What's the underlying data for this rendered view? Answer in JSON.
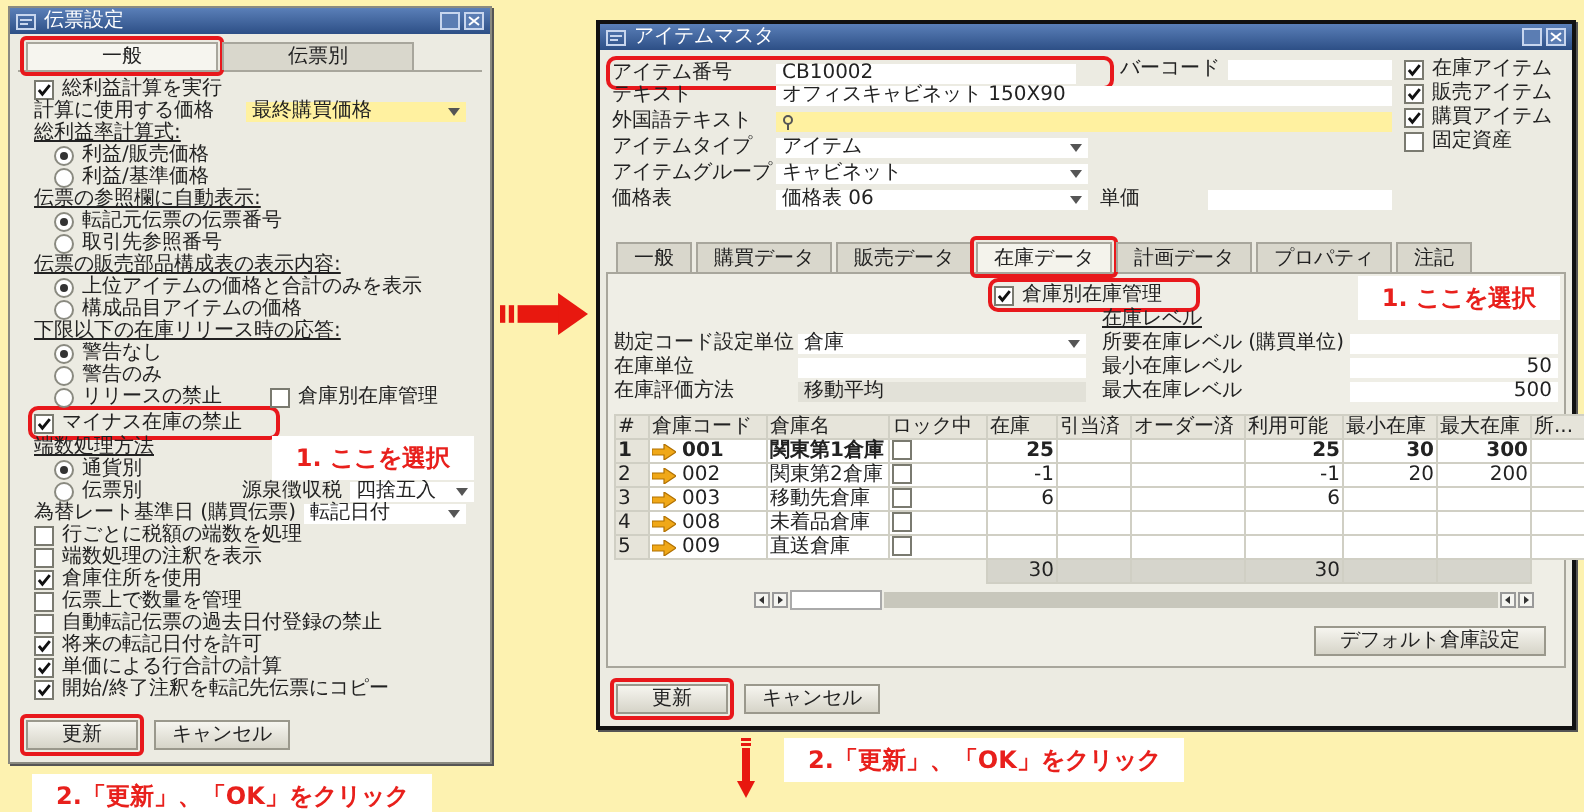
{
  "left_window": {
    "title": "伝票設定",
    "tabs": [
      {
        "label": "一般",
        "selected": true,
        "highlighted": true
      },
      {
        "label": "伝票別",
        "selected": false,
        "highlighted": false
      }
    ],
    "items": [
      {
        "kind": "checkbox",
        "label": "総利益計算を実行",
        "checked": true,
        "highlighted": false
      },
      {
        "kind": "dropdown",
        "label": "計算に使用する価格",
        "value": "最終購買価格",
        "focused": true
      },
      {
        "kind": "radio_group",
        "heading": "総利益率計算式:",
        "options": [
          {
            "label": "利益/販売価格",
            "selected": true
          },
          {
            "label": "利益/基準価格",
            "selected": false
          }
        ]
      },
      {
        "kind": "radio_group",
        "heading": "伝票の参照欄に自動表示:",
        "options": [
          {
            "label": "転記元伝票の伝票番号",
            "selected": true
          },
          {
            "label": "取引先参照番号",
            "selected": false
          }
        ]
      },
      {
        "kind": "radio_group",
        "heading": "伝票の販売部品構成表の表示内容:",
        "options": [
          {
            "label": "上位アイテムの価格と合計のみを表示",
            "selected": true
          },
          {
            "label": "構成品目アイテムの価格",
            "selected": false
          }
        ]
      },
      {
        "kind": "radio_group",
        "heading": "下限以下の在庫リリース時の応答:",
        "options": [
          {
            "label": "警告なし",
            "selected": true
          },
          {
            "label": "警告のみ",
            "selected": false
          },
          {
            "label": "リリースの禁止",
            "selected": false
          }
        ],
        "side_checkbox": {
          "label": "倉庫別在庫管理",
          "checked": false
        }
      },
      {
        "kind": "checkbox",
        "label": "マイナス在庫の禁止",
        "checked": true,
        "highlighted": true
      },
      {
        "kind": "radio_group",
        "heading": "端数処理方法",
        "options": [
          {
            "label": "通貨別",
            "selected": true
          },
          {
            "label": "伝票別",
            "selected": false
          }
        ],
        "side_dropdown": {
          "label": "源泉徴収税",
          "value": "四捨五入"
        }
      },
      {
        "kind": "dropdown",
        "label": "為替レート基準日 (購買伝票)",
        "value": "転記日付",
        "focused": false
      },
      {
        "kind": "checkbox",
        "label": "行ごとに税額の端数を処理",
        "checked": false,
        "highlighted": false
      },
      {
        "kind": "checkbox",
        "label": "端数処理の注釈を表示",
        "checked": false,
        "highlighted": false
      },
      {
        "kind": "checkbox",
        "label": "倉庫住所を使用",
        "checked": true,
        "highlighted": false
      },
      {
        "kind": "checkbox",
        "label": "伝票上で数量を管理",
        "checked": false,
        "highlighted": false
      },
      {
        "kind": "checkbox",
        "label": "自動転記伝票の過去日付登録の禁止",
        "checked": false,
        "highlighted": false
      },
      {
        "kind": "checkbox",
        "label": "将来の転記日付を許可",
        "checked": true,
        "highlighted": false
      },
      {
        "kind": "checkbox",
        "label": "単価による行合計の計算",
        "checked": true,
        "highlighted": false
      },
      {
        "kind": "checkbox",
        "label": "開始/終了注釈を転記先伝票にコピー",
        "checked": true,
        "highlighted": false
      }
    ],
    "buttons": [
      {
        "label": "更新",
        "highlighted": true
      },
      {
        "label": "キャンセル",
        "highlighted": false
      }
    ],
    "callouts": [
      "1. ここを選択",
      "2.「更新」、「OK」をクリック"
    ]
  },
  "right_window": {
    "title": "アイテムマスタ",
    "header_fields": [
      {
        "kind": "text",
        "label": "アイテム番号",
        "value": "CB10002",
        "focused": false,
        "highlighted": true
      },
      {
        "kind": "text",
        "label": "テキスト",
        "value": "オフィスキャビネット 150X90",
        "focused": false,
        "highlighted": false
      },
      {
        "kind": "text",
        "label": "外国語テキスト",
        "focused": true,
        "highlighted": false
      },
      {
        "kind": "dropdown",
        "label": "アイテムタイプ",
        "value": "アイテム",
        "highlighted": false
      },
      {
        "kind": "dropdown",
        "label": "アイテムグループ",
        "value": "キャビネット",
        "highlighted": false
      },
      {
        "kind": "dropdown",
        "label": "価格表",
        "value": "価格表 06",
        "highlighted": false
      }
    ],
    "barcode": {
      "label": "バーコード"
    },
    "unit_price": {
      "label": "単価"
    },
    "item_flags": [
      {
        "label": "在庫アイテム",
        "checked": true
      },
      {
        "label": "販売アイテム",
        "checked": true
      },
      {
        "label": "購買アイテム",
        "checked": true
      },
      {
        "label": "固定資産",
        "checked": false
      }
    ],
    "tabs": [
      {
        "label": "一般",
        "selected": false,
        "highlighted": false
      },
      {
        "label": "購買データ",
        "selected": false,
        "highlighted": false
      },
      {
        "label": "販売データ",
        "selected": false,
        "highlighted": false
      },
      {
        "label": "在庫データ",
        "selected": true,
        "highlighted": true
      },
      {
        "label": "計画データ",
        "selected": false,
        "highlighted": false
      },
      {
        "label": "プロパティ",
        "selected": false,
        "highlighted": false
      },
      {
        "label": "注記",
        "selected": false,
        "highlighted": false
      }
    ],
    "warehouse_management": {
      "label": "倉庫別在庫管理",
      "checked": true,
      "highlighted": true
    },
    "inventory_fields": [
      {
        "kind": "dropdown",
        "label": "勘定コード設定単位",
        "value": "倉庫"
      },
      {
        "kind": "text",
        "label": "在庫単位"
      },
      {
        "kind": "readonly",
        "label": "在庫評価方法",
        "value": "移動平均"
      }
    ],
    "stock_level": {
      "heading": "在庫レベル",
      "fields": [
        {
          "label": "所要在庫レベル (購買単位)"
        },
        {
          "label": "最小在庫レベル",
          "value": "50"
        },
        {
          "label": "最大在庫レベル",
          "value": "500"
        }
      ]
    },
    "table": {
      "columns": [
        "#",
        "倉庫コード",
        "倉庫名",
        "ロック中",
        "在庫",
        "引当済",
        "オーダー済",
        "利用可能",
        "最小在庫",
        "最大在庫",
        "所..."
      ],
      "rows": [
        {
          "number": "1",
          "code": "001",
          "name": "関東第1倉庫",
          "locked": false,
          "in_stock": "25",
          "available": "25",
          "min_stock": "30",
          "max_stock": "300",
          "default": true
        },
        {
          "number": "2",
          "code": "002",
          "name": "関東第2倉庫",
          "locked": false,
          "in_stock": "-1",
          "available": "-1",
          "min_stock": "20",
          "max_stock": "200",
          "default": false
        },
        {
          "number": "3",
          "code": "003",
          "name": "移動先倉庫",
          "locked": false,
          "in_stock": "6",
          "available": "6",
          "default": false
        },
        {
          "number": "4",
          "code": "008",
          "name": "未着品倉庫",
          "locked": false,
          "default": false
        },
        {
          "number": "5",
          "code": "009",
          "name": "直送倉庫",
          "locked": false,
          "default": false
        }
      ],
      "totals": {
        "in_stock": "30",
        "available": "30"
      }
    },
    "default_button": "デフォルト倉庫設定",
    "buttons": [
      {
        "label": "更新",
        "highlighted": true
      },
      {
        "label": "キャンセル",
        "highlighted": false
      }
    ],
    "callouts": [
      "1. ここを選択",
      "2.「更新」、「OK」をクリック"
    ]
  }
}
